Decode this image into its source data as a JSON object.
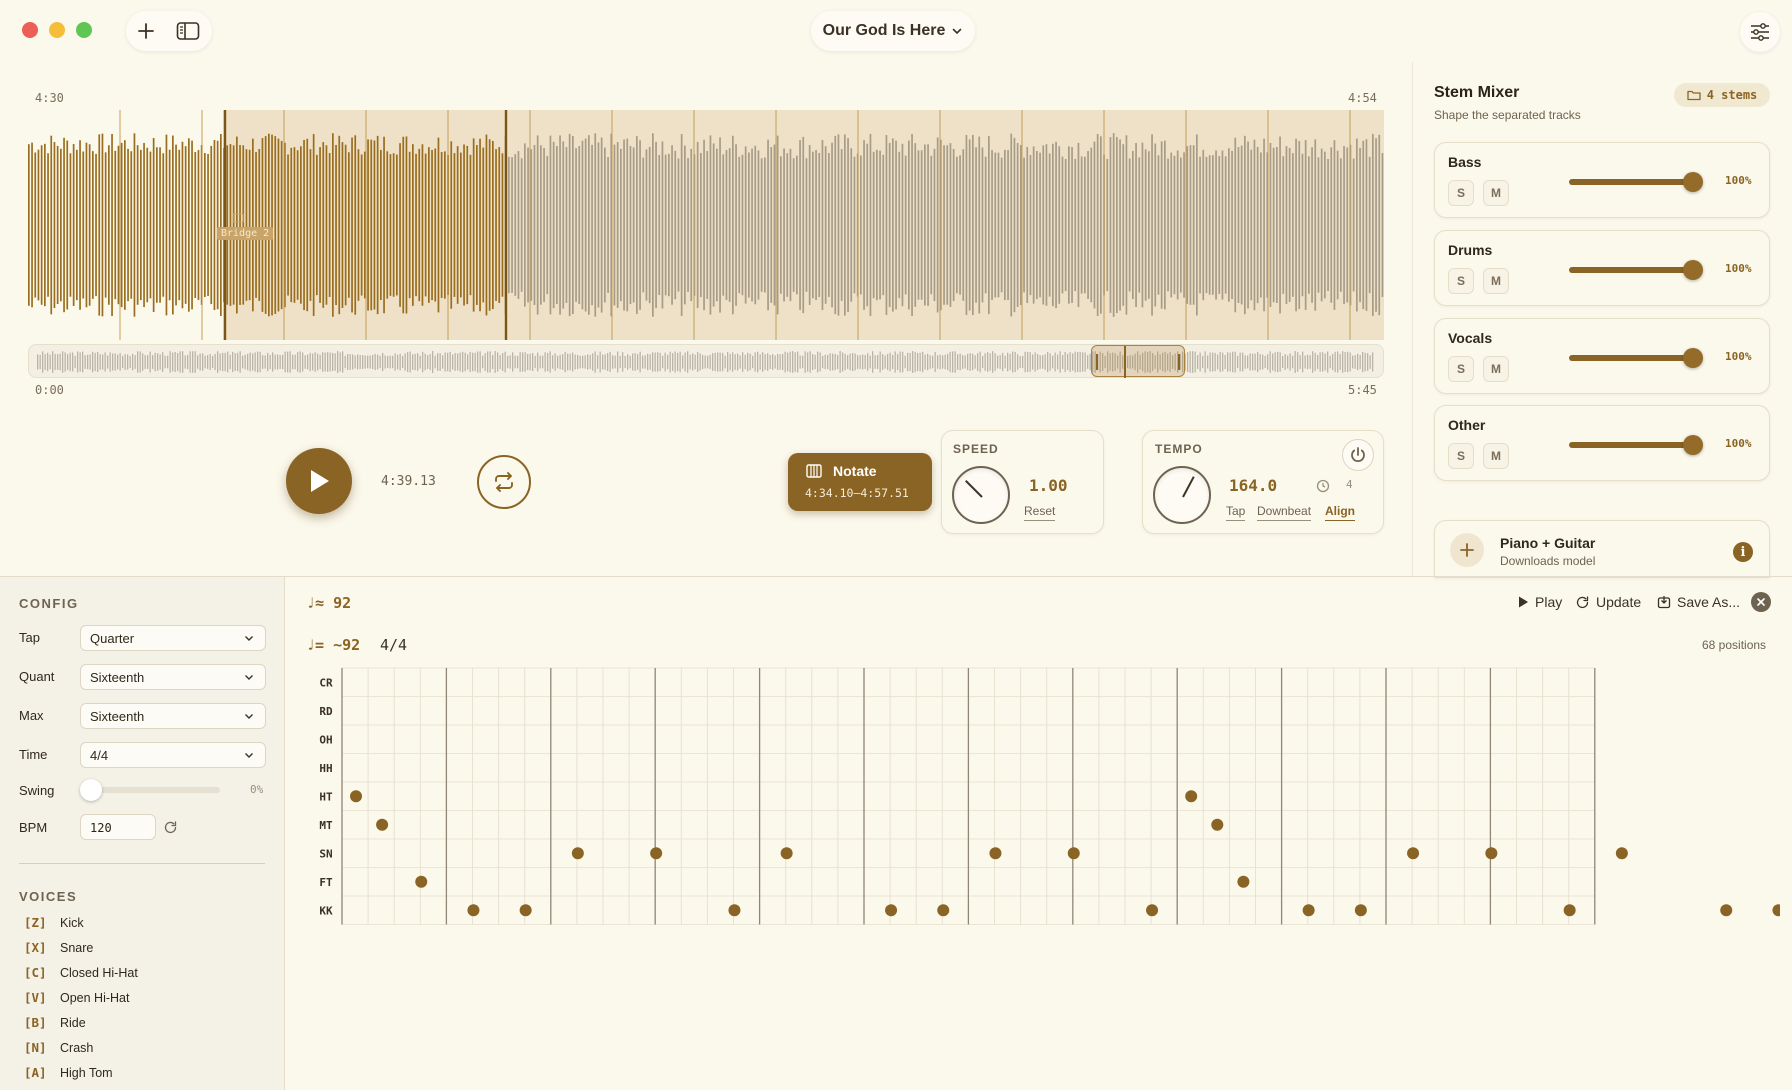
{
  "window": {
    "title": "Our God Is Here"
  },
  "waveform": {
    "view_start": "4:30",
    "view_end": "4:54",
    "section_label": "Bridge 2",
    "total_start": "0:00",
    "total_end": "5:45"
  },
  "transport": {
    "position": "4:39.13",
    "notate_label": "Notate",
    "notate_range": "4:34.10–4:57.51"
  },
  "speed": {
    "caption": "SPEED",
    "value": "1.00",
    "reset_label": "Reset"
  },
  "tempo": {
    "caption": "TEMPO",
    "value": "164.0",
    "beats": "4",
    "tap_label": "Tap",
    "downbeat_label": "Downbeat",
    "align_label": "Align"
  },
  "mixer": {
    "title": "Stem Mixer",
    "subtitle": "Shape the separated tracks",
    "stems_badge": "4 stems",
    "solo_label": "S",
    "mute_label": "M",
    "stems": [
      {
        "name": "Bass",
        "volume": "100%",
        "level": 1.0
      },
      {
        "name": "Drums",
        "volume": "100%",
        "level": 1.0
      },
      {
        "name": "Vocals",
        "volume": "100%",
        "level": 1.0
      },
      {
        "name": "Other",
        "volume": "100%",
        "level": 1.0
      }
    ],
    "extra_model": {
      "name": "Piano + Guitar",
      "note": "Downloads model"
    }
  },
  "config": {
    "caption": "CONFIG",
    "fields": [
      {
        "label": "Tap",
        "value": "Quarter"
      },
      {
        "label": "Quant",
        "value": "Sixteenth"
      },
      {
        "label": "Max",
        "value": "Sixteenth"
      },
      {
        "label": "Time",
        "value": "4/4"
      }
    ],
    "swing_label": "Swing",
    "swing_value": "0%",
    "bpm_label": "BPM",
    "bpm_value": "120"
  },
  "voices": {
    "caption": "VOICES",
    "items": [
      {
        "key": "[Z]",
        "name": "Kick"
      },
      {
        "key": "[X]",
        "name": "Snare"
      },
      {
        "key": "[C]",
        "name": "Closed Hi-Hat"
      },
      {
        "key": "[V]",
        "name": "Open Hi-Hat"
      },
      {
        "key": "[B]",
        "name": "Ride"
      },
      {
        "key": "[N]",
        "name": "Crash"
      },
      {
        "key": "[A]",
        "name": "High Tom"
      }
    ]
  },
  "notation": {
    "tempo_primary": "♩≈ 92",
    "tempo_secondary": "♩= ~92",
    "time_signature": "4/4",
    "positions_count": "68 positions",
    "play_label": "Play",
    "update_label": "Update",
    "save_label": "Save As...",
    "rows": [
      "CR",
      "RD",
      "OH",
      "HH",
      "HT",
      "MT",
      "SN",
      "FT",
      "KK"
    ],
    "hits": {
      "HT": [
        0,
        64
      ],
      "MT": [
        2,
        66
      ],
      "SN": [
        17,
        23,
        33,
        49,
        55,
        81,
        87,
        97
      ],
      "FT": [
        5,
        68
      ],
      "KK": [
        9,
        13,
        29,
        41,
        45,
        61,
        73,
        77,
        93,
        105,
        109
      ]
    }
  },
  "colors": {
    "accent": "#8a6424",
    "background": "#fbf8ec"
  }
}
